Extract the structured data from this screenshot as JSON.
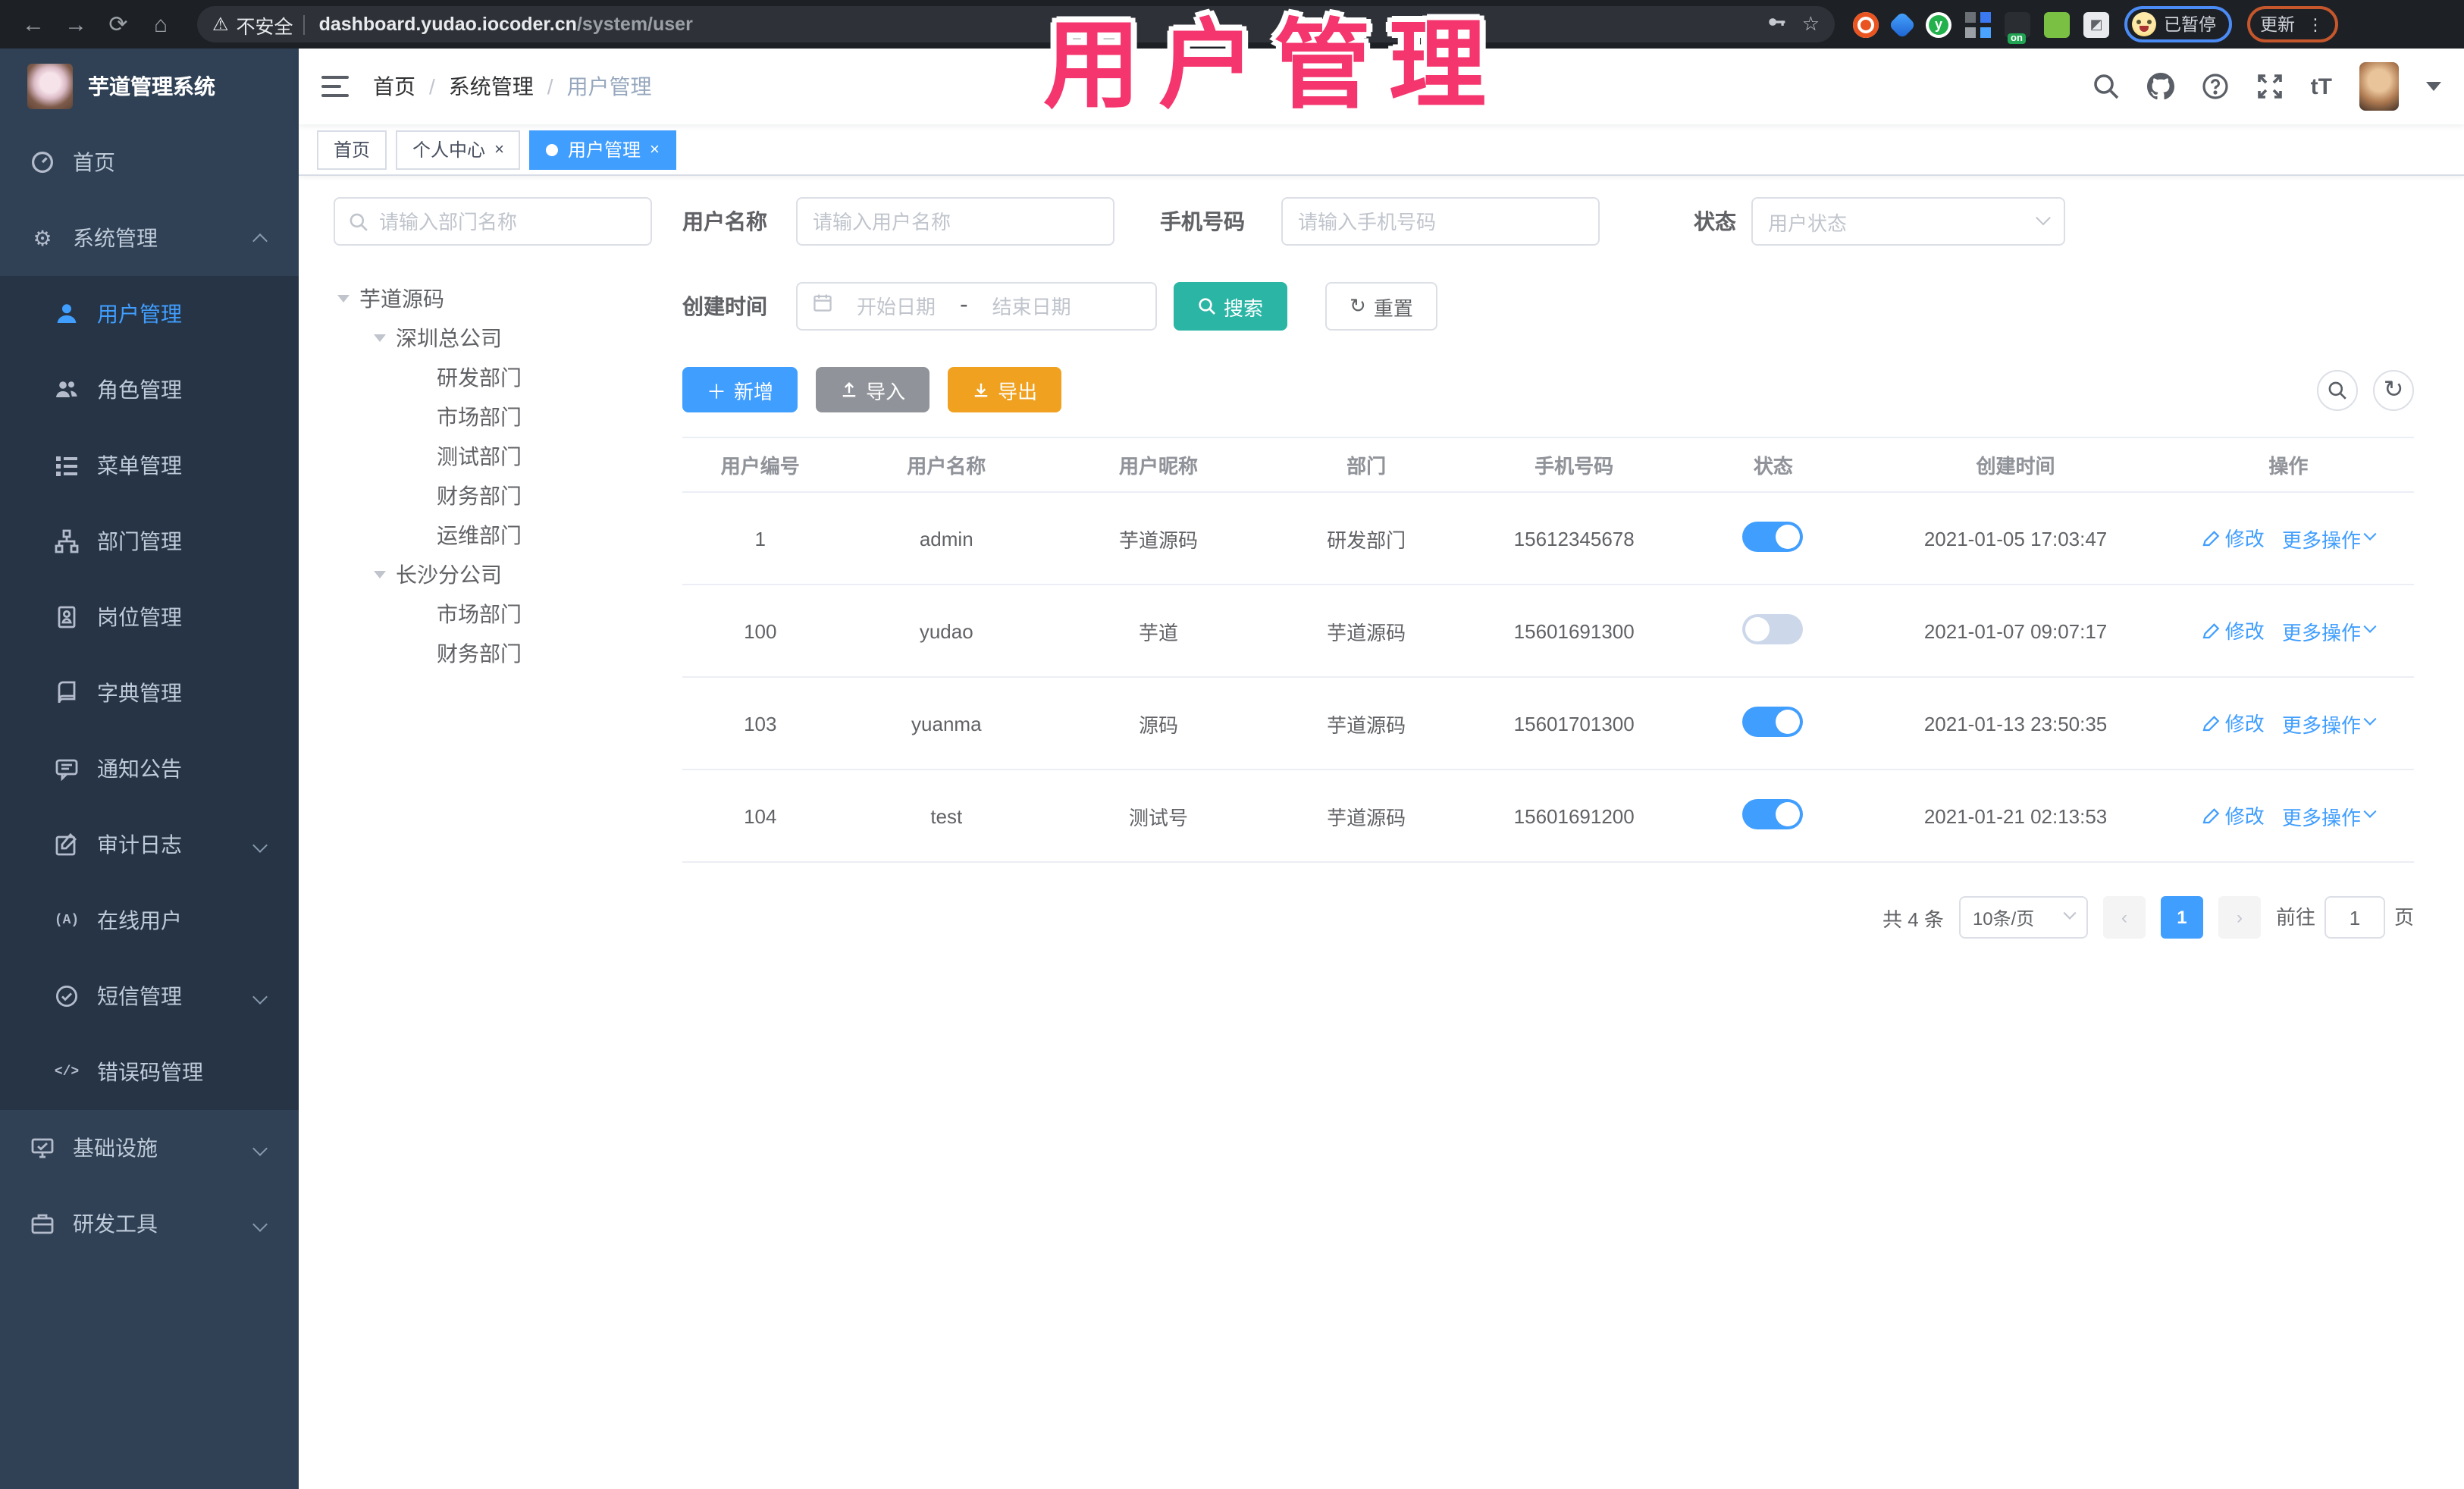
{
  "colors": {
    "primary": "#409eff",
    "search_teal": "#2ab5a5",
    "export_orange": "#f0a11f",
    "import_gray": "#909399",
    "sidebar_bg": "#304156",
    "submenu_bg": "#263445",
    "annotation_pink": "#f5356d"
  },
  "browser": {
    "security_label": "不安全",
    "url_host": "dashboard.yudao.iocoder.cn",
    "url_path": "/system/user",
    "paused_badge": "已暂停",
    "update_button": "更新",
    "icons": [
      "back-arrow-icon",
      "forward-arrow-icon",
      "reload-icon",
      "home-icon",
      "warning-icon",
      "key-icon",
      "star-icon",
      "extension-ubuntu-icon",
      "extension-gem-icon",
      "extension-green-y-icon",
      "extension-grid-icon",
      "extension-on-badge-icon",
      "extension-green-key-icon",
      "puzzle-icon",
      "profile-face-icon",
      "kebab-menu-icon"
    ]
  },
  "annotation": {
    "text": "用户管理"
  },
  "sidebar": {
    "title": "芋道管理系统",
    "items": [
      {
        "label": "首页",
        "icon": "dashboard-icon"
      },
      {
        "label": "系统管理",
        "icon": "gear-icon",
        "expanded": true
      },
      {
        "label": "用户管理",
        "icon": "user-icon",
        "active": true
      },
      {
        "label": "角色管理",
        "icon": "users-icon"
      },
      {
        "label": "菜单管理",
        "icon": "menu-list-icon"
      },
      {
        "label": "部门管理",
        "icon": "org-tree-icon"
      },
      {
        "label": "岗位管理",
        "icon": "id-badge-icon"
      },
      {
        "label": "字典管理",
        "icon": "dictionary-icon"
      },
      {
        "label": "通知公告",
        "icon": "announcement-icon"
      },
      {
        "label": "审计日志",
        "icon": "audit-log-icon",
        "collapsed": true
      },
      {
        "label": "在线用户",
        "icon": "online-user-icon"
      },
      {
        "label": "短信管理",
        "icon": "sms-icon",
        "collapsed": true
      },
      {
        "label": "错误码管理",
        "icon": "code-icon"
      },
      {
        "label": "基础设施",
        "icon": "infrastructure-icon",
        "collapsed": true
      },
      {
        "label": "研发工具",
        "icon": "toolbox-icon",
        "collapsed": true
      }
    ]
  },
  "topbar": {
    "breadcrumb": [
      "首页",
      "系统管理",
      "用户管理"
    ],
    "right_icons": [
      "search-icon",
      "github-icon",
      "help-icon",
      "fullscreen-icon",
      "font-size-icon",
      "user-avatar",
      "caret-down-icon"
    ],
    "font_size_glyph": "tT"
  },
  "tabs": [
    {
      "label": "首页",
      "closable": false,
      "active": false
    },
    {
      "label": "个人中心",
      "closable": true,
      "active": false
    },
    {
      "label": "用户管理",
      "closable": true,
      "active": true
    }
  ],
  "tab_close_glyph": "×",
  "dept_tree": {
    "search_placeholder": "请输入部门名称",
    "nodes": [
      {
        "label": "芋道源码",
        "level": 0,
        "expandable": true
      },
      {
        "label": "深圳总公司",
        "level": 1,
        "expandable": true
      },
      {
        "label": "研发部门",
        "level": 2
      },
      {
        "label": "市场部门",
        "level": 2
      },
      {
        "label": "测试部门",
        "level": 2
      },
      {
        "label": "财务部门",
        "level": 2
      },
      {
        "label": "运维部门",
        "level": 2
      },
      {
        "label": "长沙分公司",
        "level": 1,
        "expandable": true
      },
      {
        "label": "市场部门",
        "level": 2
      },
      {
        "label": "财务部门",
        "level": 2
      }
    ]
  },
  "filters": {
    "username": {
      "label": "用户名称",
      "placeholder": "请输入用户名称",
      "value": ""
    },
    "mobile": {
      "label": "手机号码",
      "placeholder": "请输入手机号码",
      "value": ""
    },
    "status": {
      "label": "状态",
      "placeholder": "用户状态"
    },
    "create_time": {
      "label": "创建时间",
      "start_placeholder": "开始日期",
      "separator": "-",
      "end_placeholder": "结束日期"
    },
    "search_button": "搜索",
    "reset_button": "重置"
  },
  "toolbar": {
    "add_label": "新增",
    "import_label": "导入",
    "export_label": "导出",
    "right_icons": [
      "search-toggle-icon",
      "refresh-icon"
    ]
  },
  "table": {
    "columns": [
      "用户编号",
      "用户名称",
      "用户昵称",
      "部门",
      "手机号码",
      "状态",
      "创建时间",
      "操作"
    ],
    "actions": {
      "edit": "修改",
      "more": "更多操作"
    },
    "rows": [
      {
        "id": "1",
        "username": "admin",
        "nickname": "芋道源码",
        "dept": "研发部门",
        "mobile": "15612345678",
        "status_on": true,
        "created": "2021-01-05 17:03:47"
      },
      {
        "id": "100",
        "username": "yudao",
        "nickname": "芋道",
        "dept": "芋道源码",
        "mobile": "15601691300",
        "status_on": false,
        "created": "2021-01-07 09:07:17"
      },
      {
        "id": "103",
        "username": "yuanma",
        "nickname": "源码",
        "dept": "芋道源码",
        "mobile": "15601701300",
        "status_on": true,
        "created": "2021-01-13 23:50:35"
      },
      {
        "id": "104",
        "username": "test",
        "nickname": "测试号",
        "dept": "芋道源码",
        "mobile": "15601691200",
        "status_on": true,
        "created": "2021-01-21 02:13:53"
      }
    ]
  },
  "pagination": {
    "total": "共 4 条",
    "page_size": "10条/页",
    "prev": "‹",
    "current": "1",
    "next": "›",
    "goto_label": "前往",
    "goto_value": "1",
    "page_unit": "页"
  }
}
